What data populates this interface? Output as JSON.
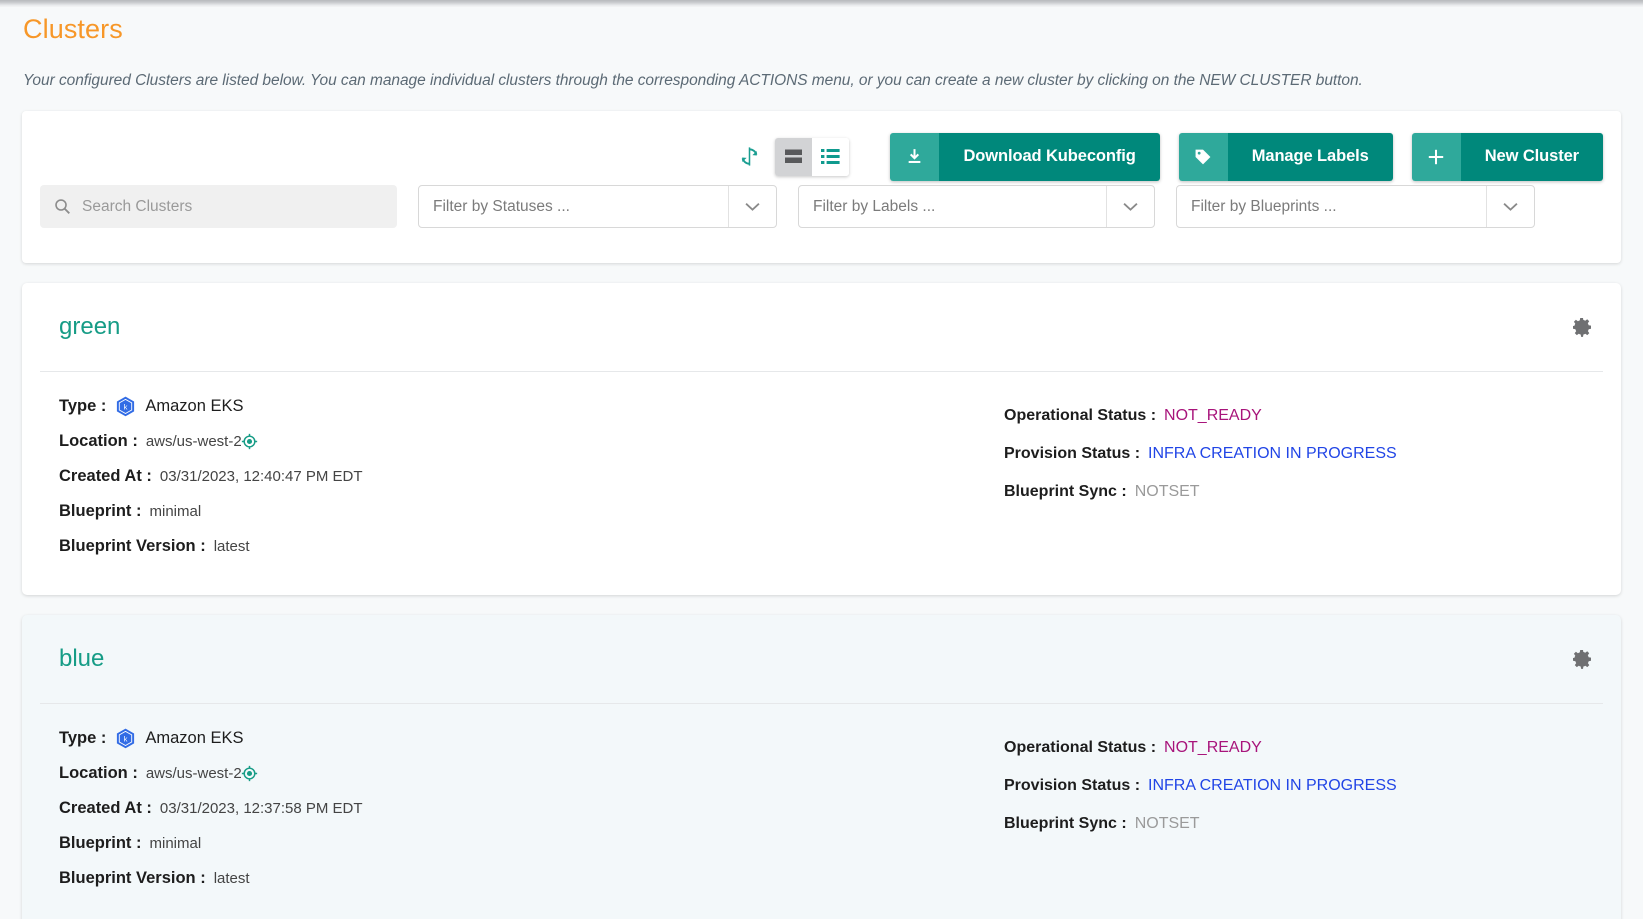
{
  "page": {
    "title": "Clusters",
    "description": "Your configured Clusters are listed below. You can manage individual clusters through the corresponding ACTIONS menu, or you can create a new cluster by clicking on the NEW CLUSTER button."
  },
  "colors": {
    "title_accent": "#f79728",
    "teal_primary": "#00887b",
    "teal_icon": "#2fa99b",
    "cluster_name": "#169c86",
    "status_not_ready": "#a8147b",
    "status_in_progress": "#2145e6",
    "status_notset": "#9a9a9a",
    "k8s_blue": "#326ce5"
  },
  "toolbar": {
    "refresh_label": "refresh-icon",
    "view_card_label": "card-view-icon",
    "view_list_label": "list-view-icon",
    "active_view": "card",
    "buttons": [
      {
        "icon": "download-icon",
        "label": "Download Kubeconfig"
      },
      {
        "icon": "tag-icon",
        "label": "Manage Labels"
      },
      {
        "icon": "plus-icon",
        "label": "New Cluster"
      }
    ]
  },
  "filters": {
    "search_placeholder": "Search Clusters",
    "search_value": "",
    "selects": [
      {
        "placeholder": "Filter by Statuses ...",
        "value": ""
      },
      {
        "placeholder": "Filter by Labels ...",
        "value": ""
      },
      {
        "placeholder": "Filter by Blueprints ...",
        "value": ""
      }
    ]
  },
  "labels": {
    "type": "Type :",
    "location": "Location :",
    "created_at": "Created At :",
    "blueprint": "Blueprint :",
    "blueprint_version": "Blueprint Version :",
    "operational_status": "Operational Status :",
    "provision_status": "Provision Status :",
    "blueprint_sync": "Blueprint Sync :"
  },
  "clusters": [
    {
      "name": "green",
      "type": "Amazon EKS",
      "location": "aws/us-west-2",
      "created_at": "03/31/2023, 12:40:47 PM EDT",
      "blueprint": "minimal",
      "blueprint_version": "latest",
      "operational_status": "NOT_READY",
      "provision_status": "INFRA CREATION IN PROGRESS",
      "blueprint_sync": "NOTSET"
    },
    {
      "name": "blue",
      "type": "Amazon EKS",
      "location": "aws/us-west-2",
      "created_at": "03/31/2023, 12:37:58 PM EDT",
      "blueprint": "minimal",
      "blueprint_version": "latest",
      "operational_status": "NOT_READY",
      "provision_status": "INFRA CREATION IN PROGRESS",
      "blueprint_sync": "NOTSET"
    }
  ]
}
